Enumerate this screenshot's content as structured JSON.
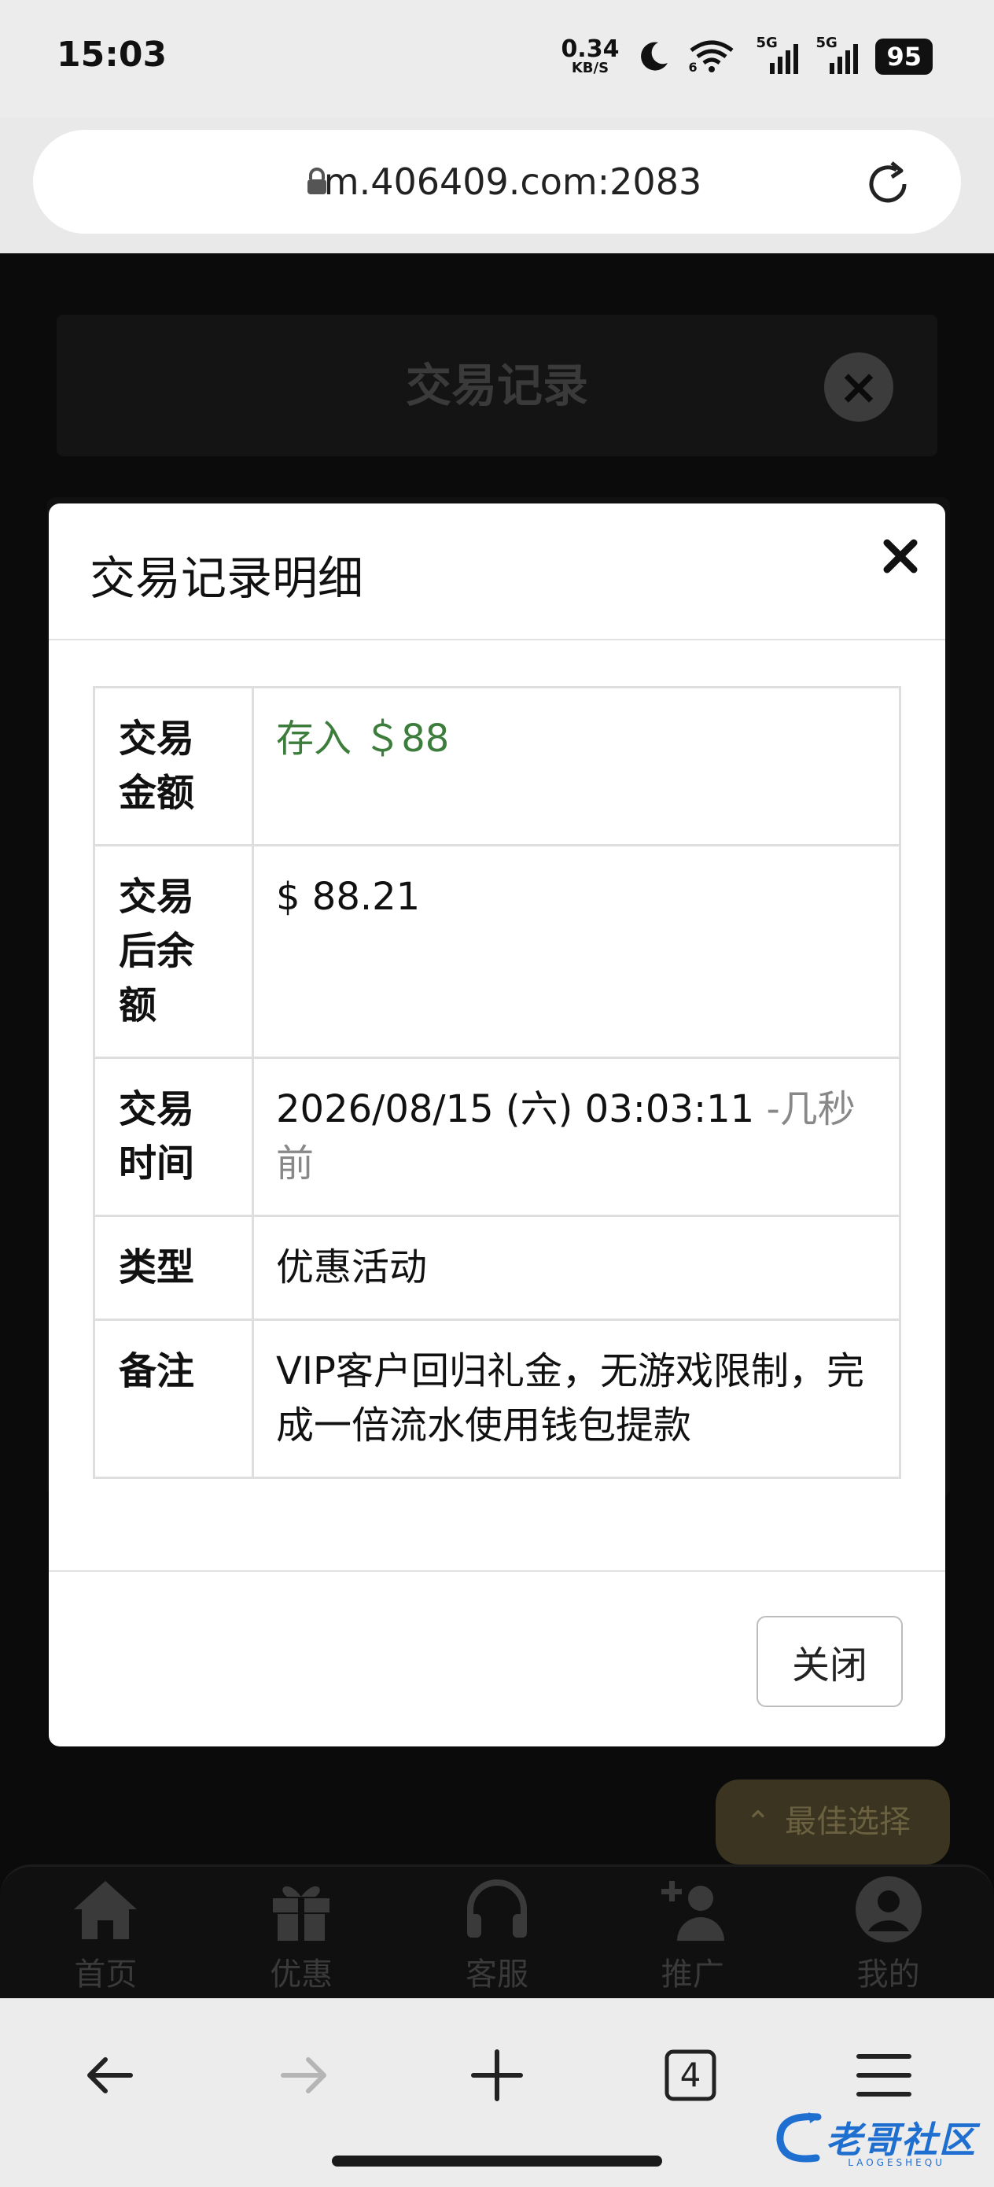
{
  "status_bar": {
    "time": "15:03",
    "net_speed_value": "0.34",
    "net_speed_unit": "KB/S",
    "signal_label": "5G",
    "wifi_badge": "6",
    "battery": "95"
  },
  "address_bar": {
    "url": "m.406409.com:2083"
  },
  "background_page": {
    "title": "交易记录",
    "best_choice_label": "最佳选择",
    "tabs": [
      {
        "label": "首页",
        "icon": "home-icon"
      },
      {
        "label": "优惠",
        "icon": "gift-icon"
      },
      {
        "label": "客服",
        "icon": "headset-icon"
      },
      {
        "label": "推广",
        "icon": "add-user-icon"
      },
      {
        "label": "我的",
        "icon": "user-icon"
      }
    ]
  },
  "modal": {
    "title": "交易记录明细",
    "rows": [
      {
        "key": "交易金额",
        "value": "存入 ＄88"
      },
      {
        "key": "交易后余额",
        "value": "$ 88.21"
      },
      {
        "key": "交易时间",
        "value": "2026/08/15 (六) 03:03:11",
        "relative": "-几秒前"
      },
      {
        "key": "类型",
        "value": "优惠活动"
      },
      {
        "key": "备注",
        "value": "VIP客户回归礼金，无游戏限制，完成一倍流水使用钱包提款"
      }
    ],
    "close_label": "关闭"
  },
  "bottom_bar": {
    "tab_count": "4"
  },
  "watermark": {
    "text": "老哥社区",
    "sub": "LAOGESHEQU"
  },
  "colors": {
    "deposit_green": "#3c7d3c",
    "overlay": "#0b0b0b",
    "accent_gold": "#3a3420"
  }
}
